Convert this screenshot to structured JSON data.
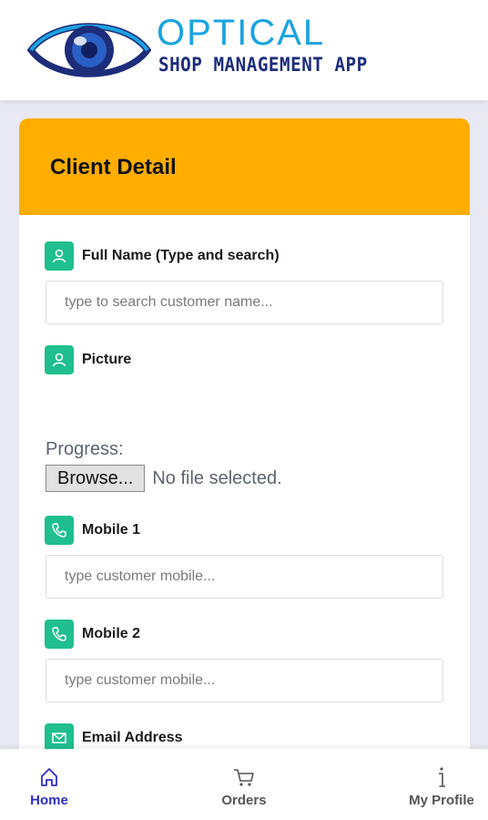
{
  "header": {
    "logo_title": "OPTICAL",
    "logo_subtitle": "SHOP MANAGEMENT APP"
  },
  "card": {
    "title": "Client Detail",
    "fields": {
      "full_name": {
        "label": "Full Name (Type and search)",
        "placeholder": "type to search customer name...",
        "value": ""
      },
      "picture": {
        "label": "Picture",
        "progress_label": "Progress:",
        "browse_label": "Browse...",
        "file_status": "No file selected."
      },
      "mobile1": {
        "label": "Mobile 1",
        "placeholder": "type customer mobile...",
        "value": ""
      },
      "mobile2": {
        "label": "Mobile 2",
        "placeholder": "type customer mobile...",
        "value": ""
      },
      "email": {
        "label": "Email Address"
      }
    }
  },
  "nav": {
    "items": [
      {
        "label": "Home",
        "icon": "home-icon",
        "active": true
      },
      {
        "label": "Orders",
        "icon": "cart-icon",
        "active": false
      },
      {
        "label": "My Profile",
        "icon": "info-icon",
        "active": false
      }
    ]
  },
  "colors": {
    "accent": "#ffad00",
    "icon_bg": "#1fbf8f",
    "nav_active": "#2e2ec8",
    "nav_inactive": "#555555",
    "logo_blue": "#1aa3e0",
    "logo_navy": "#1d2d7a"
  }
}
